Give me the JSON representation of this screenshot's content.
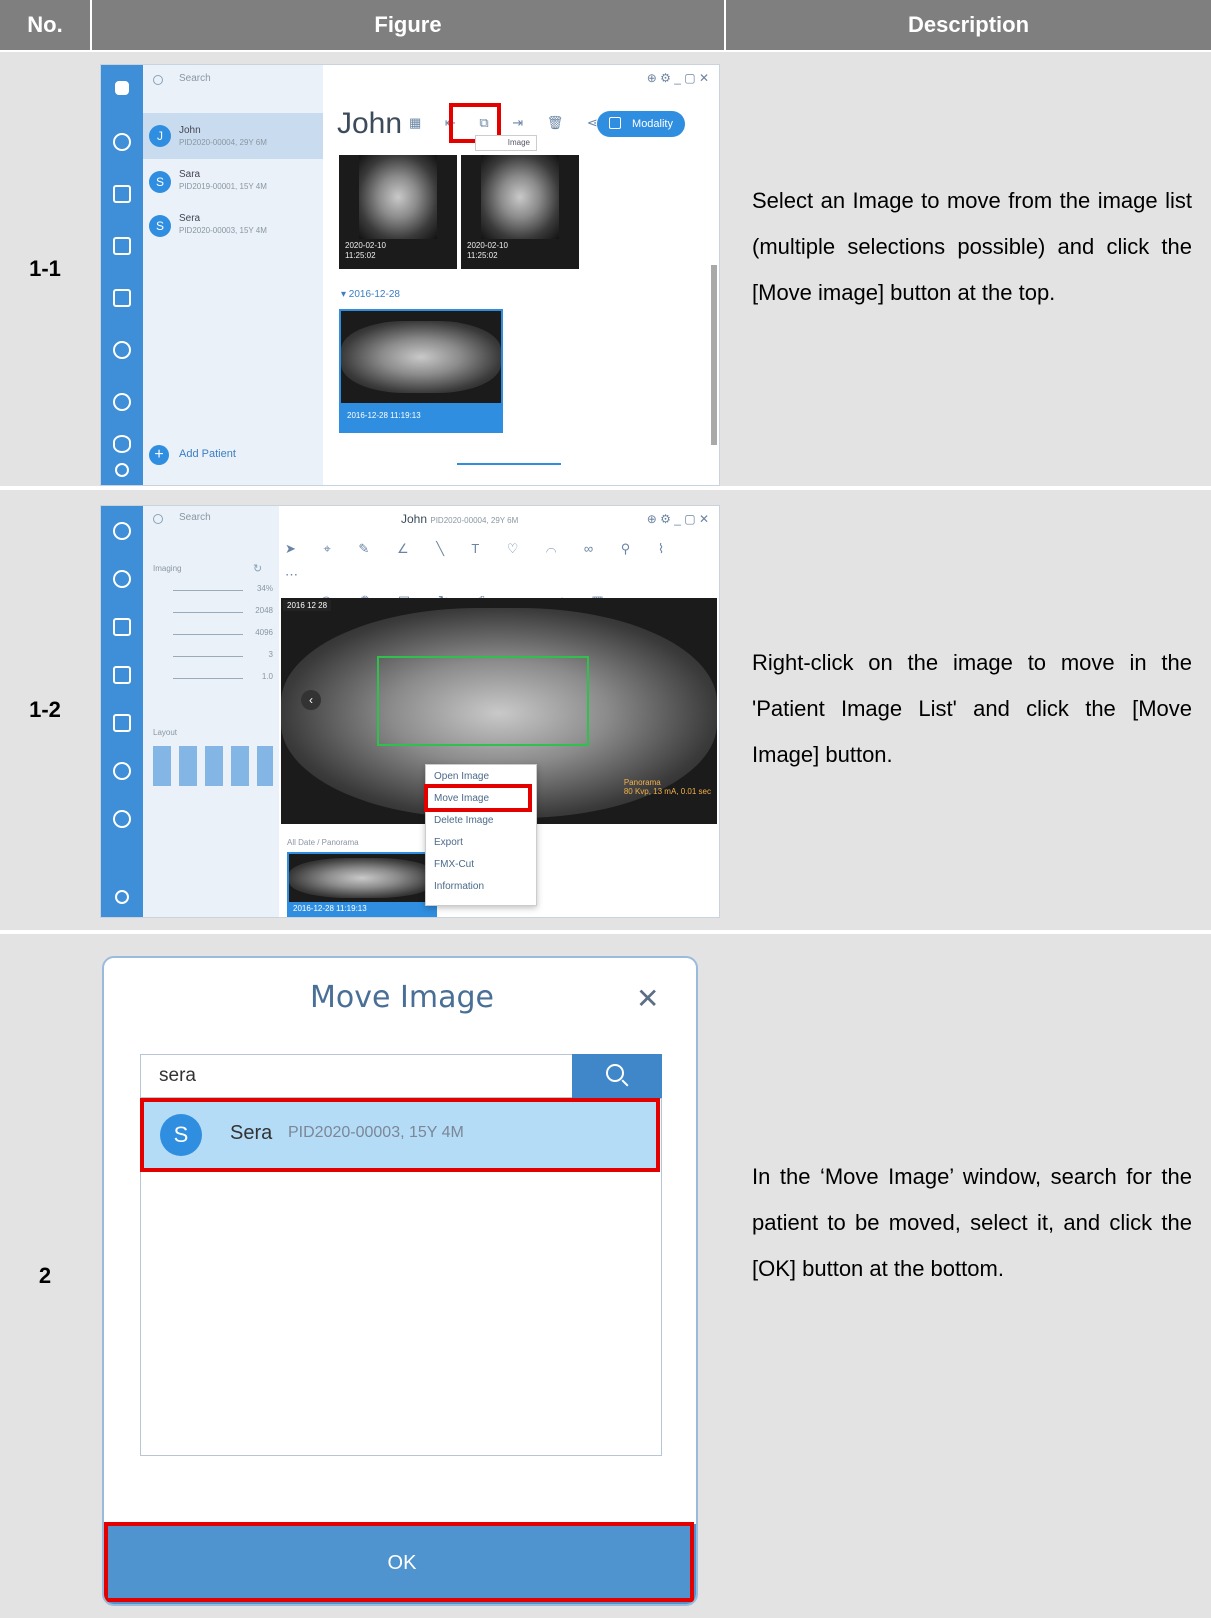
{
  "header": {
    "no": "No.",
    "figure": "Figure",
    "description": "Description"
  },
  "rows": [
    {
      "no": "1-1",
      "description": "Select an Image to move from the image list (multiple selections possible) and click the [Move image] button at the top."
    },
    {
      "no": "1-2",
      "description": "Right-click on the image to move in the 'Patient Image List' and click the [Move Image] button."
    },
    {
      "no": "2",
      "description": "In the ‘Move Image’ window, search for the patient to be moved, select it, and click the [OK] button at the bottom."
    }
  ],
  "fig1": {
    "search_placeholder": "Search",
    "patients": [
      {
        "initial": "J",
        "name": "John",
        "info": "PID2020-00004, 29Y 6M"
      },
      {
        "initial": "S",
        "name": "Sara",
        "info": "PID2019-00001, 15Y 4M"
      },
      {
        "initial": "S",
        "name": "Sera",
        "info": "PID2020-00003, 15Y 4M"
      }
    ],
    "add_patient": "Add Patient",
    "title": "John",
    "modality": "Modality",
    "tooltip": "Image",
    "thumbs": [
      {
        "date": "2020-02-10",
        "time": "11:25:02"
      },
      {
        "date": "2020-02-10",
        "time": "11:25:02"
      }
    ],
    "group_date": "▾ 2016-12-28",
    "pano_label": "2016-12-28 11:19:13"
  },
  "fig2": {
    "search_placeholder": "Search",
    "title": "John",
    "subtitle": "PID2020-00004, 29Y 6M",
    "imaging_label": "Imaging",
    "sliders": [
      "34%",
      "2048",
      "4096",
      "3",
      "1.0"
    ],
    "layout_label": "Layout",
    "date_tag": "2016 12 28",
    "filter": "All Date / Panorama",
    "thumb_label": "2016-12-28 11:19:13",
    "pano_info_title": "Panorama",
    "pano_info": "80 Kvp, 13 mA, 0.01 sec",
    "context_menu": [
      "Open Image",
      "Move Image",
      "Delete Image",
      "Export",
      "FMX-Cut",
      "Information"
    ]
  },
  "dialog": {
    "title": "Move Image",
    "search_value": "sera",
    "result_initial": "S",
    "result_name": "Sera",
    "result_info": "PID2020-00003, 15Y 4M",
    "ok": "OK"
  }
}
